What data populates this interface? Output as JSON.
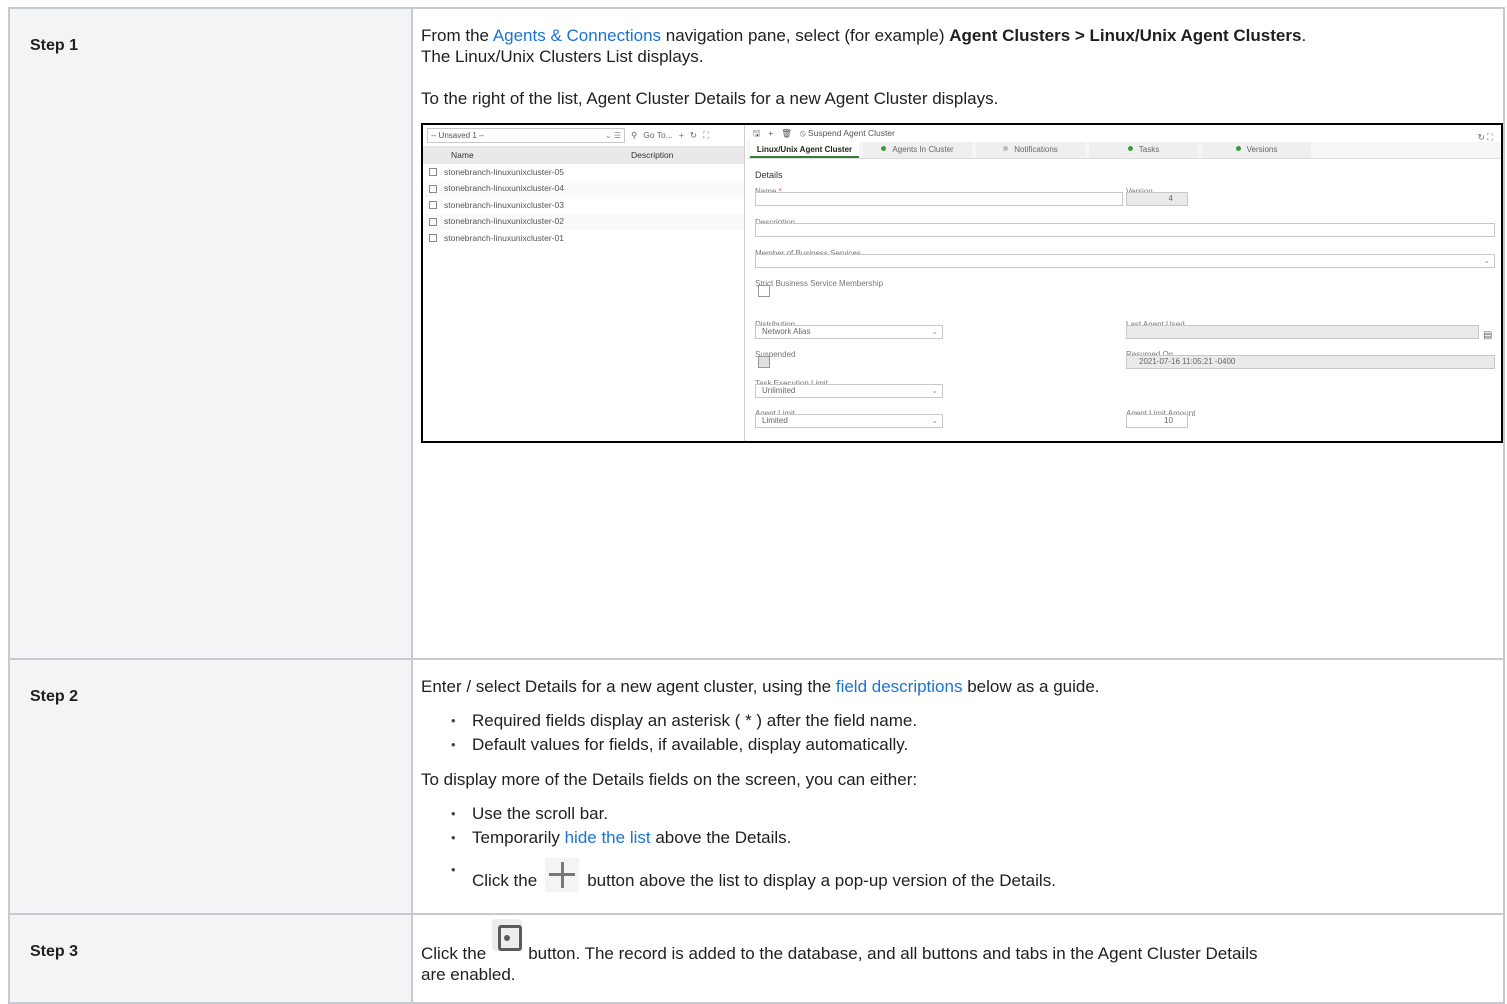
{
  "steps": [
    {
      "label": "Step 1",
      "p1_pre": "From the ",
      "p1_link": "Agents & Connections",
      "p1_mid": " navigation pane, select (for example) ",
      "p1_bold": "Agent Clusters > Linux/Unix Agent Clusters",
      "p1_post": ".",
      "p1_line2": "The Linux/Unix Clusters List displays.",
      "p2": "To the right of the list, Agent Cluster Details for a new Agent Cluster displays."
    },
    {
      "label": "Step 2",
      "p1_pre": "Enter / select Details for a new agent cluster, using the ",
      "p1_link": "field descriptions",
      "p1_post": " below as a guide.",
      "bullets1": [
        "Required fields display an asterisk ( * ) after the field name.",
        "Default values for fields, if available, display automatically."
      ],
      "p2": "To display more of the Details fields on the screen, you can either:",
      "bullet_a": "Use the scroll bar.",
      "bullet_b_pre": "Temporarily ",
      "bullet_b_link": "hide the list",
      "bullet_b_post": " above the Details.",
      "bullet_c_pre": "Click the",
      "bullet_c_post": "button above the list to display a pop-up version of the Details."
    },
    {
      "label": "Step 3",
      "p_pre": "Click the",
      "p_post": "button. The record is added to the database, and all buttons and tabs in the Agent Cluster Details",
      "p_line2": "are enabled."
    }
  ],
  "screenshot": {
    "filter_value": "-- Unsaved 1 --",
    "goto_label": "Go To...",
    "list_columns": [
      "Name",
      "Description"
    ],
    "list_rows": [
      "stonebranch-linuxunixcluster-05",
      "stonebranch-linuxunixcluster-04",
      "stonebranch-linuxunixcluster-03",
      "stonebranch-linuxunixcluster-02",
      "stonebranch-linuxunixcluster-01"
    ],
    "toolbar_action": "Suspend Agent Cluster",
    "tabs": [
      {
        "label": "Linux/Unix Agent Cluster",
        "active": true
      },
      {
        "label": "Agents In Cluster",
        "dot": "#3c9a3c"
      },
      {
        "label": "Notifications",
        "dot": "#bbbbbb"
      },
      {
        "label": "Tasks",
        "dot": "#3c9a3c"
      },
      {
        "label": "Versions",
        "dot": "#3c9a3c"
      }
    ],
    "form": {
      "section": "Details",
      "name_label": "Name",
      "version_label": "Version",
      "version_value": "4",
      "description_label": "Description",
      "member_label": "Member of Business Services",
      "strict_label": "Strict Business Service Membership",
      "distribution_label": "Distribution",
      "distribution_value": "Network Alias",
      "last_agent_label": "Last Agent Used",
      "suspended_label": "Suspended",
      "resumed_label": "Resumed On",
      "resumed_value": "2021-07-16 11:05:21 -0400",
      "task_limit_label": "Task Execution Limit",
      "task_limit_value": "Unlimited",
      "agent_limit_label": "Agent Limit",
      "agent_limit_value": "Limited",
      "agent_limit_amount_label": "Agent Limit Amount",
      "agent_limit_amount_value": "10"
    }
  }
}
